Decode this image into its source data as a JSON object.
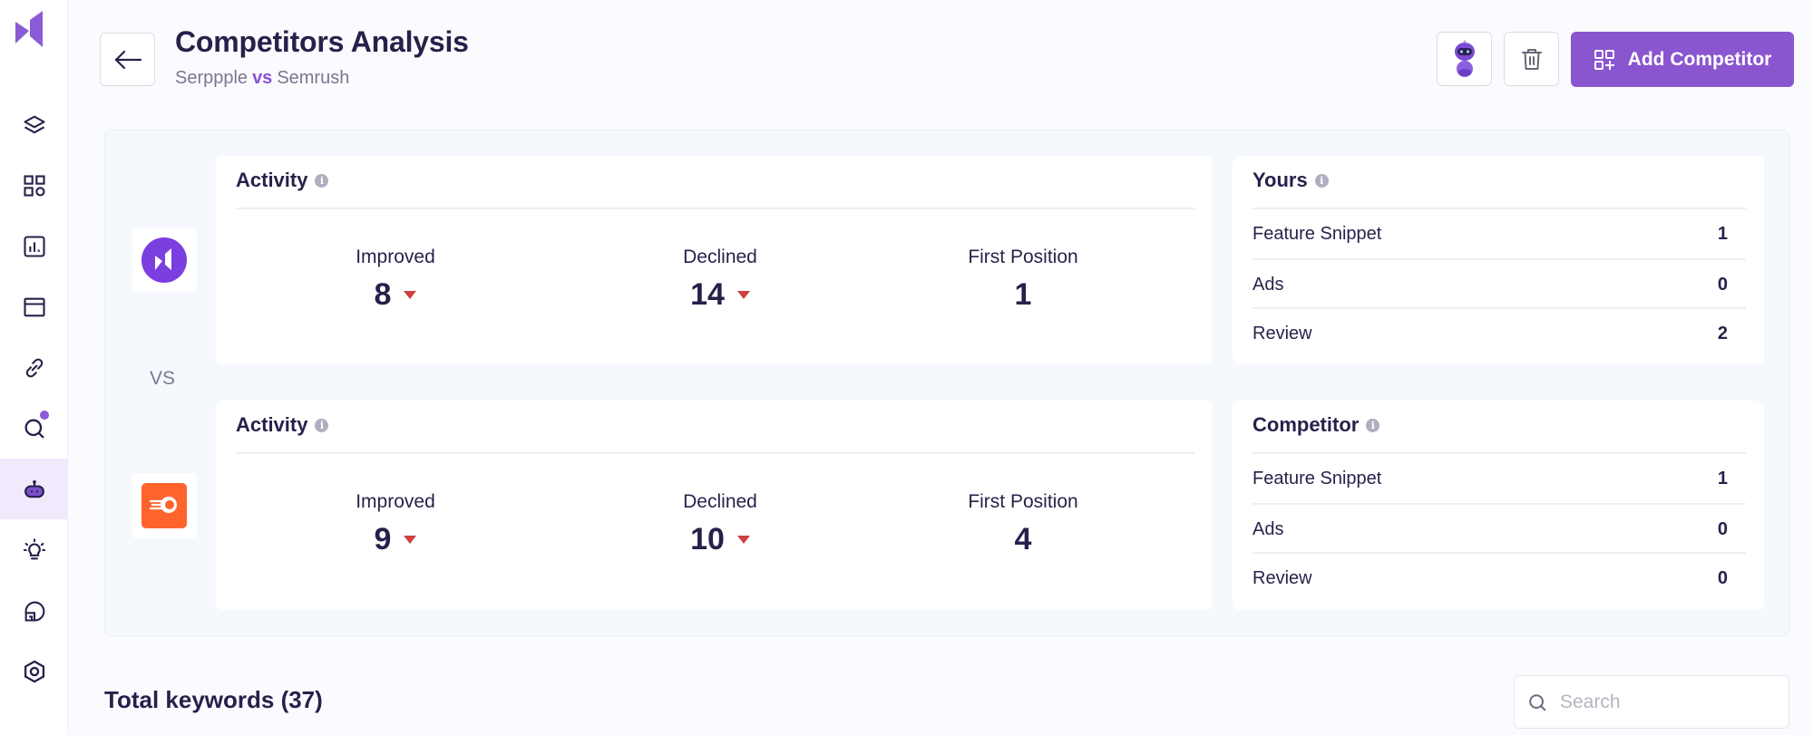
{
  "sidebar": {
    "items": [
      {
        "name": "layers",
        "active": false
      },
      {
        "name": "dashboard",
        "active": false
      },
      {
        "name": "reports",
        "active": false
      },
      {
        "name": "browser",
        "active": false
      },
      {
        "name": "links",
        "active": false
      },
      {
        "name": "search",
        "active": false,
        "badge": true
      },
      {
        "name": "ai-bot",
        "active": true
      },
      {
        "name": "ideas",
        "active": false
      },
      {
        "name": "analytics",
        "active": false
      },
      {
        "name": "settings",
        "active": false
      }
    ],
    "accent": "#8a5bd6"
  },
  "header": {
    "title": "Competitors Analysis",
    "subtitle_left": "Serppple",
    "subtitle_vs": "vs",
    "subtitle_right": "Semrush",
    "add_button": "Add Competitor"
  },
  "comparison": {
    "vs_label": "VS",
    "yours": {
      "brand": "Serppple",
      "brand_color": "#7b3fe0",
      "activity": {
        "title": "Activity",
        "metrics": [
          {
            "label": "Improved",
            "value": "8",
            "trend": "down"
          },
          {
            "label": "Declined",
            "value": "14",
            "trend": "down"
          },
          {
            "label": "First Position",
            "value": "1",
            "trend": null
          }
        ]
      },
      "features": {
        "title": "Yours",
        "rows": [
          {
            "label": "Feature Snippet",
            "value": "1"
          },
          {
            "label": "Ads",
            "value": "0"
          },
          {
            "label": "Review",
            "value": "2"
          }
        ]
      }
    },
    "competitor": {
      "brand": "Semrush",
      "brand_color": "#ff642d",
      "activity": {
        "title": "Activity",
        "metrics": [
          {
            "label": "Improved",
            "value": "9",
            "trend": "down"
          },
          {
            "label": "Declined",
            "value": "10",
            "trend": "down"
          },
          {
            "label": "First Position",
            "value": "4",
            "trend": null
          }
        ]
      },
      "features": {
        "title": "Competitor",
        "rows": [
          {
            "label": "Feature Snippet",
            "value": "1"
          },
          {
            "label": "Ads",
            "value": "0"
          },
          {
            "label": "Review",
            "value": "0"
          }
        ]
      }
    }
  },
  "keywords": {
    "title": "Total keywords (37)",
    "search_placeholder": "Search",
    "search_value": ""
  },
  "colors": {
    "primary": "#8a56cf",
    "text": "#2a1f4a",
    "trend_down": "#d13e3e"
  }
}
